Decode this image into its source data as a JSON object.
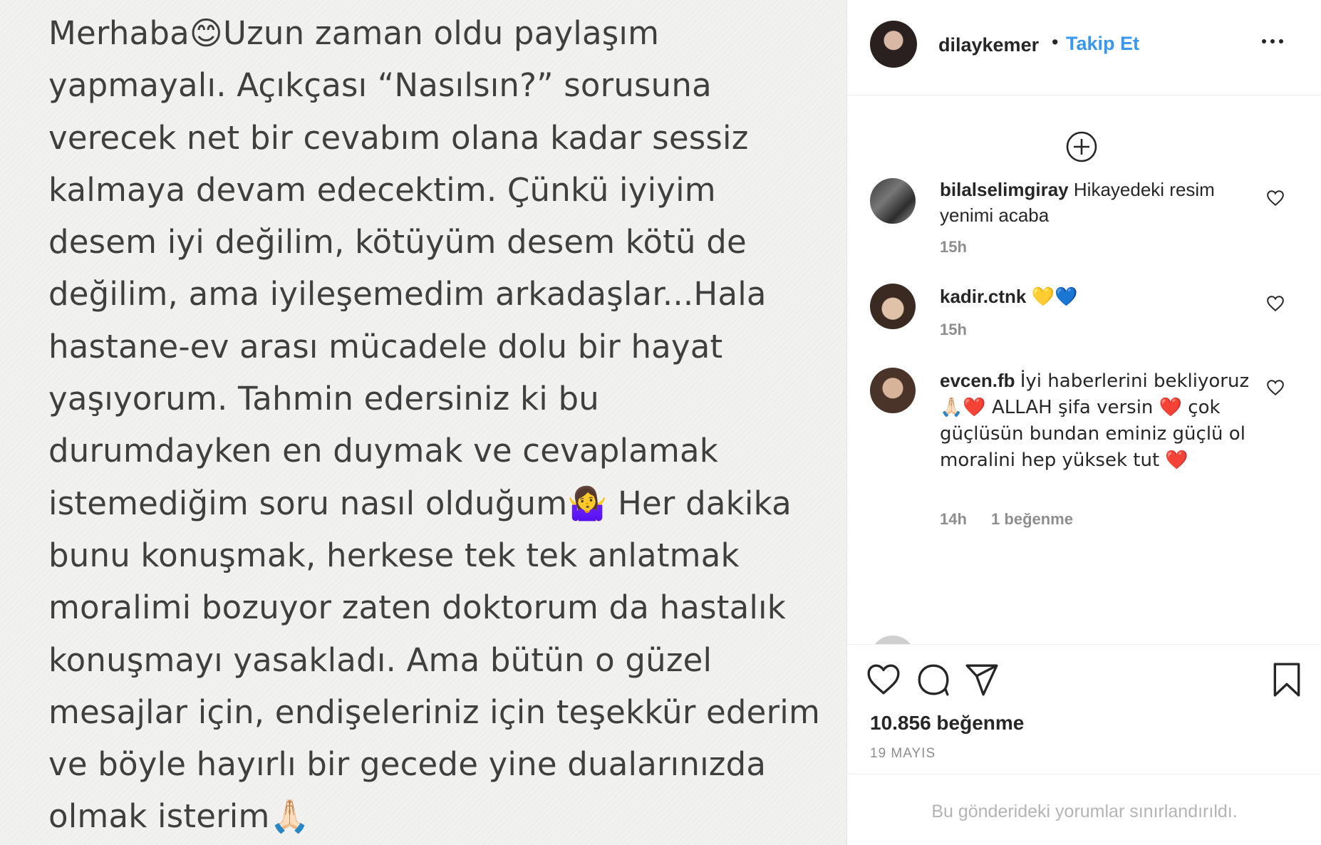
{
  "post_image": {
    "lines": [
      "Merhaba😊Uzun zaman oldu paylaşım",
      "yapmayalı. Açıkçası “Nasılsın?” sorusuna",
      "verecek net bir cevabım olana kadar sessiz",
      "kalmaya devam edecektim. Çünkü iyiyim",
      "desem iyi değilim, kötüyüm desem kötü de",
      "değilim, ama iyileşemedim arkadaşlar...Hala",
      "hastane-ev arası mücadele dolu bir hayat",
      "yaşıyorum. Tahmin edersiniz ki bu",
      "durumdayken en duymak ve cevaplamak",
      "istemediğim soru nasıl olduğum🤷‍♀️ Her dakika",
      "bunu konuşmak, herkese tek tek anlatmak",
      "moralimi bozuyor zaten doktorum da hastalık",
      "konuşmayı yasakladı. Ama bütün o güzel",
      "mesajlar için, endişeleriniz için teşekkür ederim",
      "ve böyle hayırlı bir gecede yine dualarınızda",
      "olmak isterim🙏🏻"
    ]
  },
  "header": {
    "username": "dilaykemer",
    "separator": "•",
    "follow_label": "Takip Et",
    "more_icon": "more-options-icon"
  },
  "comments": [
    {
      "username": "bilalselimgiray",
      "text": "Hikayedeki resim yenimi acaba",
      "time": "15h",
      "likes": ""
    },
    {
      "username": "kadir.ctnk",
      "text": "💛💙",
      "time": "15h",
      "likes": ""
    },
    {
      "username": "evcen.fb",
      "text": "İyi haberlerini bekliyoruz🙏🏻❤️ ALLAH şifa versin ❤️ çok güçlüsün bundan eminiz güçlü ol moralini hep yüksek tut ❤️",
      "time": "14h",
      "likes": "1 beğenme"
    }
  ],
  "actions": {
    "like_icon": "heart-icon",
    "comment_icon": "comment-icon",
    "share_icon": "share-icon",
    "save_icon": "bookmark-icon",
    "likes_count": "10.856 beğenme",
    "date": "19 MAYIS"
  },
  "footer": {
    "comments_limited": "Bu gönderideki yorumlar sınırlandırıldı."
  },
  "colors": {
    "link": "#3897f0",
    "text": "#262626",
    "muted": "#8e8e8e"
  }
}
